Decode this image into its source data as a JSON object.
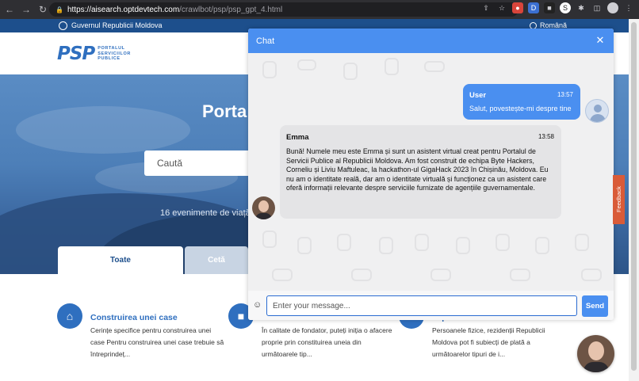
{
  "browser": {
    "url_host": "https://aisearch.optdevtech.com",
    "url_path": "/crawlbot/psp/psp_gpt_4.html"
  },
  "gov_bar": {
    "label": "Guvernul Republicii Moldova",
    "language": "Română"
  },
  "logo": {
    "mark": "PSP",
    "line1": "PORTALUL",
    "line2": "SERVICIILOR",
    "line3": "PUBLICE"
  },
  "hero": {
    "title": "Porta",
    "search_placeholder": "Caută",
    "subtitle": "16 evenimente de viață"
  },
  "tabs": [
    {
      "label": "Toate"
    },
    {
      "label": "Cetă"
    }
  ],
  "cards": [
    {
      "title": "Construirea unei case",
      "description": "Cerințe specifice pentru construirea unei case Pentru construirea unei case trebuie să întreprindeț..."
    },
    {
      "title": "",
      "description": "În calitate de fondator, puteți iniția o afacere proprie prin constituirea uneia din următoarele tip..."
    },
    {
      "title": "impozitelor/taxelor de către c...",
      "description": "Persoanele fizice, rezidenții Republicii Moldova pot fi subiecți de plată a următoarelor tipuri de i..."
    }
  ],
  "chat": {
    "title": "Chat",
    "messages": [
      {
        "author": "User",
        "time": "13:57",
        "text": "Salut, povestește-mi despre tine"
      },
      {
        "author": "Emma",
        "time": "13:58",
        "text": "Bună! Numele meu este Emma și sunt un asistent virtual creat pentru Portalul de Servicii Publice al Republicii Moldova. Am fost construit de echipa Byte Hackers, Corneliu și Liviu Maftuleac, la hackathon-ul GigaHack 2023 în Chișinău, Moldova. Eu nu am o identitate reală, dar am o identitate virtuală și funcționez ca un asistent care oferă informații relevante despre serviciile furnizate de agențiile guvernamentale."
      }
    ],
    "input_placeholder": "Enter your message...",
    "send_label": "Send"
  },
  "feedback_label": "Feedback",
  "colors": {
    "chat_accent": "#4a8ff0",
    "gov_bar": "#1d4f8c",
    "feedback": "#d95b38"
  }
}
